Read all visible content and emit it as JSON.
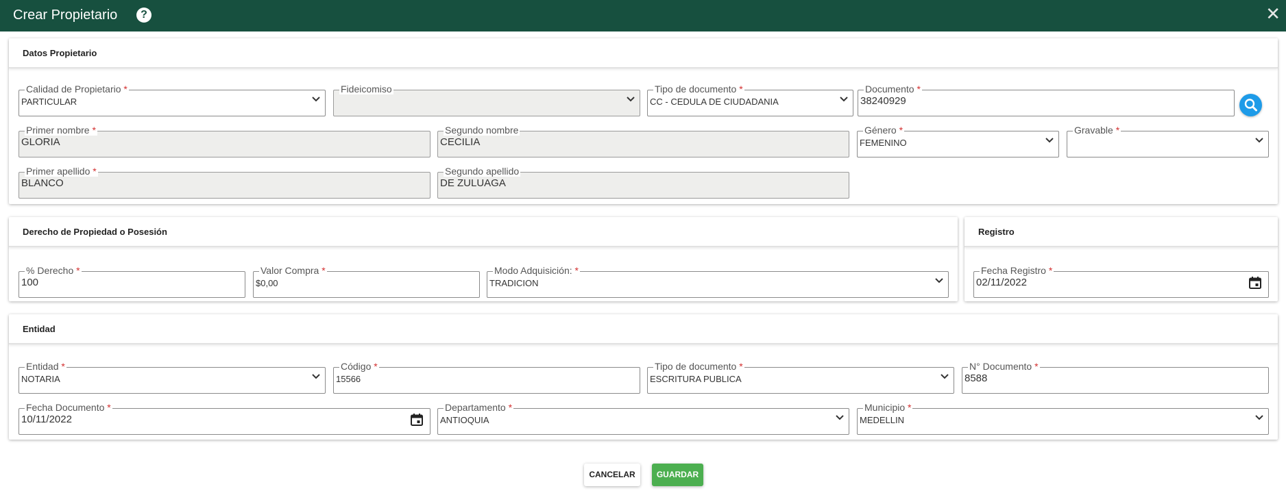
{
  "window": {
    "title": "Crear Propietario",
    "help_icon": "help-icon",
    "close_symbol": "✕"
  },
  "sections": {
    "datos": "Datos Propietario",
    "derecho": "Derecho de Propiedad o Posesión",
    "registro": "Registro",
    "entidad": "Entidad"
  },
  "propietario": {
    "calidad": {
      "label": "Calidad de Propietario",
      "value": "PARTICULAR"
    },
    "fideicomiso": {
      "label": "Fideicomiso",
      "value": ""
    },
    "tipo_documento": {
      "label": "Tipo de documento",
      "value": "CC - CEDULA DE CIUDADANIA"
    },
    "documento": {
      "label": "Documento",
      "value": "38240929"
    },
    "primer_nombre": {
      "label": "Primer nombre",
      "value": "GLORIA"
    },
    "segundo_nombre": {
      "label": "Segundo nombre",
      "value": "CECILIA"
    },
    "genero": {
      "label": "Género",
      "value": "FEMENINO"
    },
    "gravable": {
      "label": "Gravable",
      "value": ""
    },
    "primer_apellido": {
      "label": "Primer apellido",
      "value": "BLANCO"
    },
    "segundo_apellido": {
      "label": "Segundo apellido",
      "value": "DE ZULUAGA"
    }
  },
  "derecho": {
    "porcentaje": {
      "label": "% Derecho",
      "value": "100"
    },
    "valor_compra": {
      "label": "Valor Compra",
      "value": "$0,00"
    },
    "modo": {
      "label": "Modo Adquisición:",
      "value": "TRADICION"
    }
  },
  "registro": {
    "fecha": {
      "label": "Fecha Registro",
      "value": "02/11/2022"
    }
  },
  "entidad": {
    "entidad": {
      "label": "Entidad",
      "value": "NOTARIA"
    },
    "codigo": {
      "label": "Código",
      "value": "15566"
    },
    "tipo_documento": {
      "label": "Tipo de documento",
      "value": "ESCRITURA PUBLICA"
    },
    "numero_documento": {
      "label": "N° Documento",
      "value": "8588"
    },
    "fecha_documento": {
      "label": "Fecha Documento",
      "value": "10/11/2022"
    },
    "departamento": {
      "label": "Departamento",
      "value": "ANTIOQUIA"
    },
    "municipio": {
      "label": "Municipio",
      "value": "MEDELLIN"
    }
  },
  "required_mark": "*",
  "buttons": {
    "cancel": "CANCELAR",
    "save": "GUARDAR"
  },
  "colors": {
    "header": "#17503f",
    "required": "#d32f2f",
    "search": "#1e9be8",
    "save": "#4caf50"
  }
}
